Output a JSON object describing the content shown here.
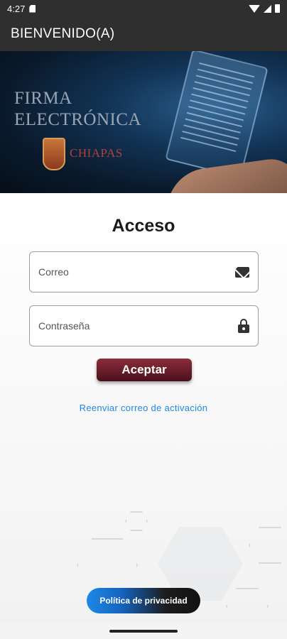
{
  "status_bar": {
    "time": "4:27"
  },
  "app_bar": {
    "title": "BIENVENIDO(A)"
  },
  "banner": {
    "title_line1": "FIRMA",
    "title_line2": "ELECTRÓNICA",
    "org_name": "CHIAPAS"
  },
  "form": {
    "heading": "Acceso",
    "email_placeholder": "Correo",
    "email_icon": "mail-icon",
    "password_placeholder": "Contraseña",
    "password_icon": "lock-icon",
    "submit_label": "Aceptar",
    "resend_link": "Reenviar correo de activación"
  },
  "footer": {
    "privacy_label": "Política de privacidad"
  },
  "colors": {
    "app_bar": "#2f2f2f",
    "accept_button": "#6b1a2a",
    "link": "#1e88e5",
    "privacy_button_start": "#1e88e5",
    "privacy_button_end": "#111111"
  }
}
